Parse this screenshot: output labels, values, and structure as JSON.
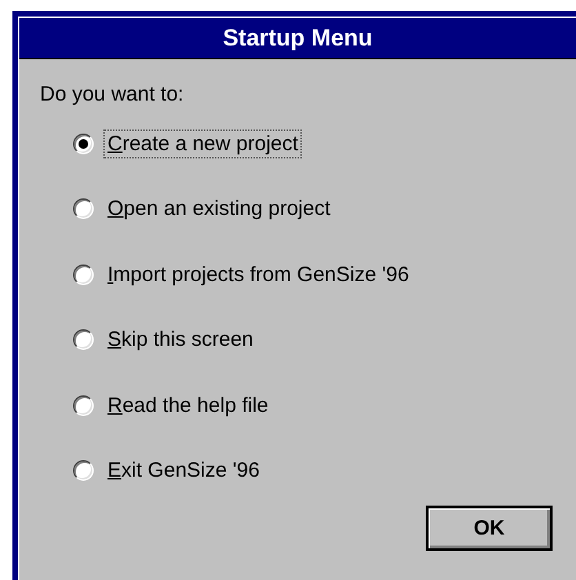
{
  "window": {
    "title": "Startup Menu"
  },
  "prompt": "Do you want to:",
  "options": [
    {
      "label": "Create a new project",
      "selected": true
    },
    {
      "label": "Open an existing project",
      "selected": false
    },
    {
      "label": "Import projects from GenSize '96",
      "selected": false
    },
    {
      "label": "Skip this screen",
      "selected": false
    },
    {
      "label": "Read the help file",
      "selected": false
    },
    {
      "label": "Exit GenSize '96",
      "selected": false
    }
  ],
  "buttons": [
    "OK"
  ]
}
